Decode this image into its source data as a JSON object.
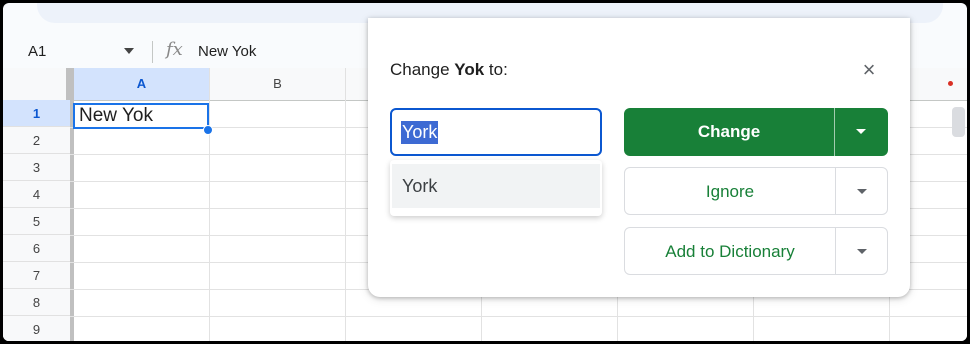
{
  "formula_bar": {
    "name_box": "A1",
    "fx_label": "fx",
    "value": "New Yok"
  },
  "columns": [
    "A",
    "B"
  ],
  "rows": [
    "1",
    "2",
    "3",
    "4",
    "5",
    "6",
    "7",
    "8",
    "9"
  ],
  "cells": {
    "A1": "New Yok"
  },
  "dialog": {
    "title_prefix": "Change ",
    "title_word": "Yok",
    "title_suffix": " to:",
    "input_value": "York",
    "suggestions": [
      "York"
    ],
    "change_label": "Change",
    "ignore_label": "Ignore",
    "dictionary_label": "Add to Dictionary"
  },
  "colors": {
    "accent_green": "#188038",
    "selection_blue": "#1a73e8"
  }
}
